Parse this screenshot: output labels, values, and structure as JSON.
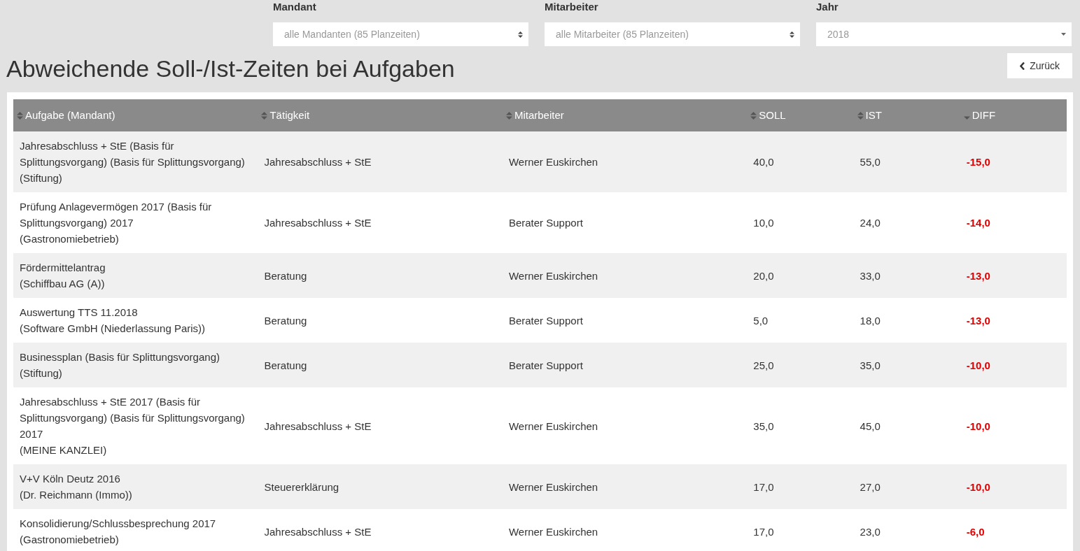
{
  "filters": [
    {
      "label": "Mandant",
      "value": "alle Mandanten (85 Planzeiten)",
      "kind": "updown"
    },
    {
      "label": "Mitarbeiter",
      "value": "alle Mitarbeiter (85 Planzeiten)",
      "kind": "updown"
    },
    {
      "label": "Jahr",
      "value": "2018",
      "kind": "down"
    }
  ],
  "title": "Abweichende Soll-/Ist-Zeiten bei Aufgaben",
  "back_button": {
    "label": "Zurück"
  },
  "table": {
    "columns": [
      {
        "label": "Aufgabe (Mandant)",
        "sorted_descending": false
      },
      {
        "label": "Tätigkeit",
        "sorted_descending": false
      },
      {
        "label": "Mitarbeiter",
        "sorted_descending": false
      },
      {
        "label": "SOLL",
        "sorted_descending": false
      },
      {
        "label": "IST",
        "sorted_descending": false
      },
      {
        "label": "DIFF",
        "sorted_descending": true
      }
    ],
    "rows": [
      {
        "task": "Jahresabschluss + StE (Basis für Splittungsvorgang) (Basis für Splittungsvorgang)",
        "client": "(Stiftung)",
        "activity": "Jahresabschluss + StE",
        "employee": "Werner Euskirchen",
        "soll": "40,0",
        "ist": "55,0",
        "diff": "-15,0"
      },
      {
        "task": "Prüfung Anlagevermögen 2017 (Basis für Splittungsvorgang) 2017",
        "client": "(Gastronomiebetrieb)",
        "activity": "Jahresabschluss + StE",
        "employee": "Berater Support",
        "soll": "10,0",
        "ist": "24,0",
        "diff": "-14,0"
      },
      {
        "task": "Fördermittelantrag",
        "client": "(Schiffbau AG (A))",
        "activity": "Beratung",
        "employee": "Werner Euskirchen",
        "soll": "20,0",
        "ist": "33,0",
        "diff": "-13,0"
      },
      {
        "task": "Auswertung TTS 11.2018",
        "client": "(Software GmbH (Niederlassung Paris))",
        "activity": "Beratung",
        "employee": "Berater Support",
        "soll": "5,0",
        "ist": "18,0",
        "diff": "-13,0"
      },
      {
        "task": "Businessplan (Basis für Splittungsvorgang)",
        "client": "(Stiftung)",
        "activity": "Beratung",
        "employee": "Berater Support",
        "soll": "25,0",
        "ist": "35,0",
        "diff": "-10,0"
      },
      {
        "task": "Jahresabschluss + StE 2017 (Basis für Splittungsvorgang) (Basis für Splittungsvorgang) 2017",
        "client": "(MEINE KANZLEI)",
        "activity": "Jahresabschluss + StE",
        "employee": "Werner Euskirchen",
        "soll": "35,0",
        "ist": "45,0",
        "diff": "-10,0"
      },
      {
        "task": "V+V Köln Deutz 2016",
        "client": "(Dr. Reichmann (Immo))",
        "activity": "Steuererklärung",
        "employee": "Werner Euskirchen",
        "soll": "17,0",
        "ist": "27,0",
        "diff": "-10,0"
      },
      {
        "task": "Konsolidierung/Schlussbesprechung 2017",
        "client": "(Gastronomiebetrieb)",
        "activity": "Jahresabschluss + StE",
        "employee": "Werner Euskirchen",
        "soll": "17,0",
        "ist": "23,0",
        "diff": "-6,0"
      }
    ]
  }
}
